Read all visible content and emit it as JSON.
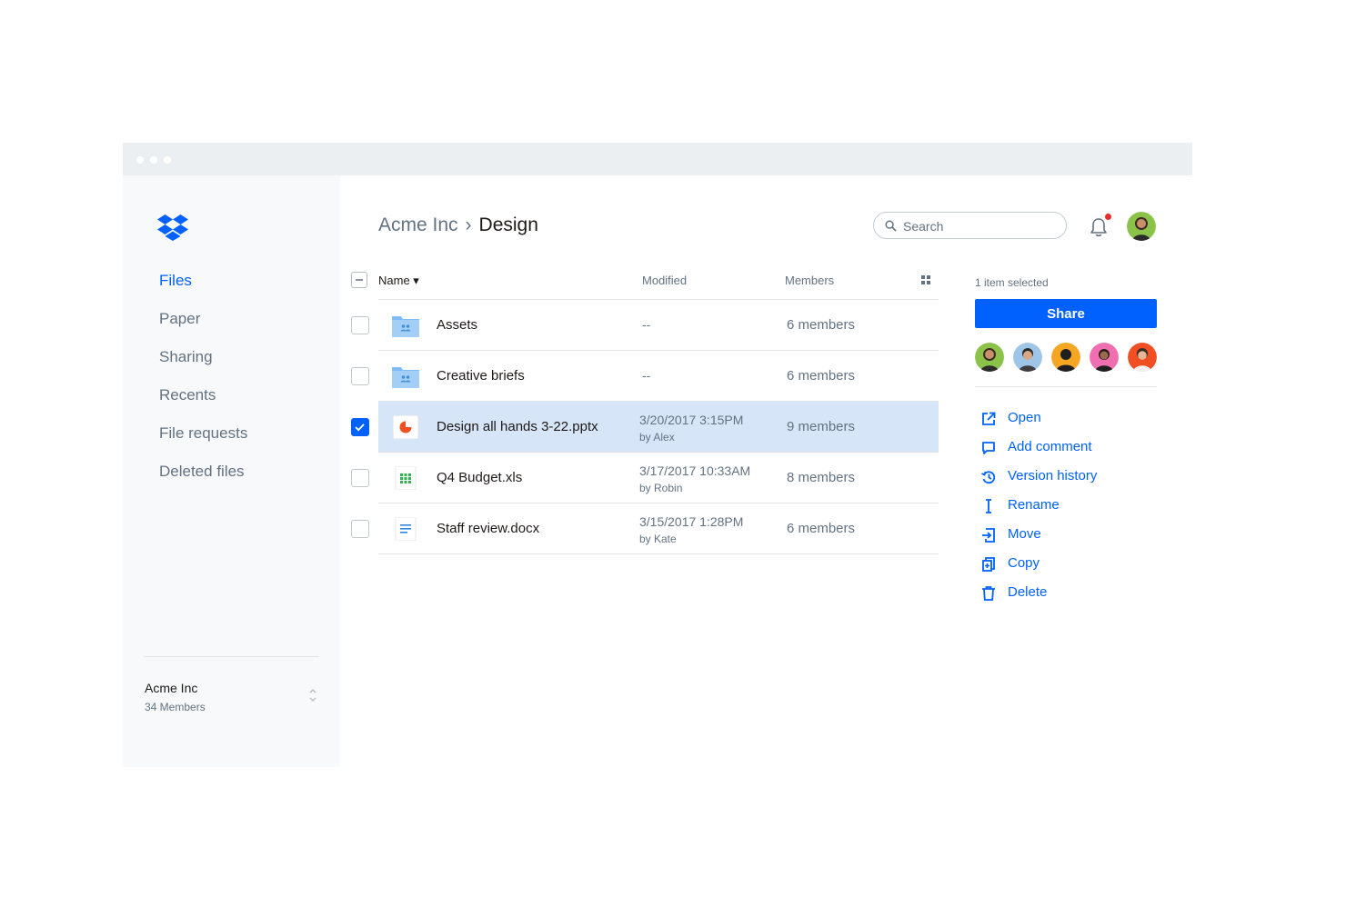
{
  "sidebar": {
    "nav": [
      {
        "label": "Files",
        "active": true
      },
      {
        "label": "Paper",
        "active": false
      },
      {
        "label": "Sharing",
        "active": false
      },
      {
        "label": "Recents",
        "active": false
      },
      {
        "label": "File requests",
        "active": false
      },
      {
        "label": "Deleted files",
        "active": false
      }
    ],
    "team": {
      "name": "Acme Inc",
      "members": "34 Members"
    }
  },
  "header": {
    "breadcrumb": {
      "parent": "Acme Inc",
      "separator": "›",
      "current": "Design"
    },
    "search": {
      "placeholder": "Search",
      "value": ""
    },
    "notification_dot": true
  },
  "table": {
    "columns": {
      "name": "Name ▾",
      "modified": "Modified",
      "members": "Members"
    },
    "rows": [
      {
        "name": "Assets",
        "icon": "shared-folder-icon",
        "modified": "--",
        "by": "",
        "members": "6 members",
        "checked": false
      },
      {
        "name": "Creative briefs",
        "icon": "shared-folder-icon",
        "modified": "--",
        "by": "",
        "members": "6 members",
        "checked": false
      },
      {
        "name": "Design all hands 3-22.pptx",
        "icon": "presentation-file-icon",
        "modified": "3/20/2017 3:15PM",
        "by": "by Alex",
        "members": "9 members",
        "checked": true
      },
      {
        "name": "Q4 Budget.xls",
        "icon": "spreadsheet-file-icon",
        "modified": "3/17/2017 10:33AM",
        "by": "by Robin",
        "members": "8 members",
        "checked": false
      },
      {
        "name": "Staff review.docx",
        "icon": "document-file-icon",
        "modified": "3/15/2017 1:28PM",
        "by": "by Kate",
        "members": "6 members",
        "checked": false
      }
    ]
  },
  "details": {
    "selected_count": "1 item selected",
    "share_label": "Share",
    "actions": [
      {
        "label": "Open",
        "icon": "open-external-icon"
      },
      {
        "label": "Add comment",
        "icon": "comment-icon"
      },
      {
        "label": "Version history",
        "icon": "version-history-icon"
      },
      {
        "label": "Rename",
        "icon": "rename-cursor-icon"
      },
      {
        "label": "Move",
        "icon": "move-icon"
      },
      {
        "label": "Copy",
        "icon": "copy-icon"
      },
      {
        "label": "Delete",
        "icon": "trash-icon"
      }
    ]
  },
  "colors": {
    "accent": "#0061fe",
    "selected_row": "#d7e5f8",
    "sidebar_bg": "#f7f9fa",
    "folder": "#7fbcf5"
  }
}
